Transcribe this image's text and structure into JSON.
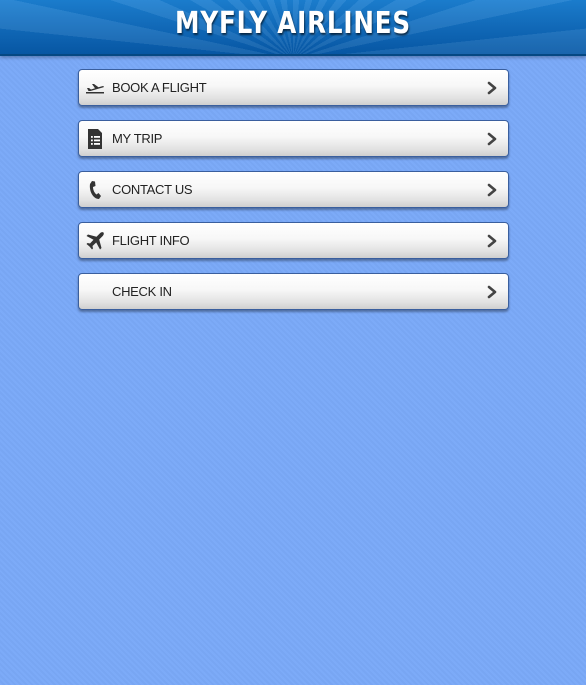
{
  "header": {
    "title": "MYFLY AIRLINES"
  },
  "menu": {
    "items": [
      {
        "label": "BOOK A FLIGHT",
        "icon": "plane-takeoff-icon"
      },
      {
        "label": "MY TRIP",
        "icon": "document-list-icon"
      },
      {
        "label": "CONTACT US",
        "icon": "phone-icon"
      },
      {
        "label": "FLIGHT INFO",
        "icon": "airplane-icon"
      },
      {
        "label": "CHECK IN",
        "icon": ""
      }
    ]
  },
  "colors": {
    "background": "#7aa9f8",
    "header": "#0a63b4",
    "item_text": "#222222"
  }
}
